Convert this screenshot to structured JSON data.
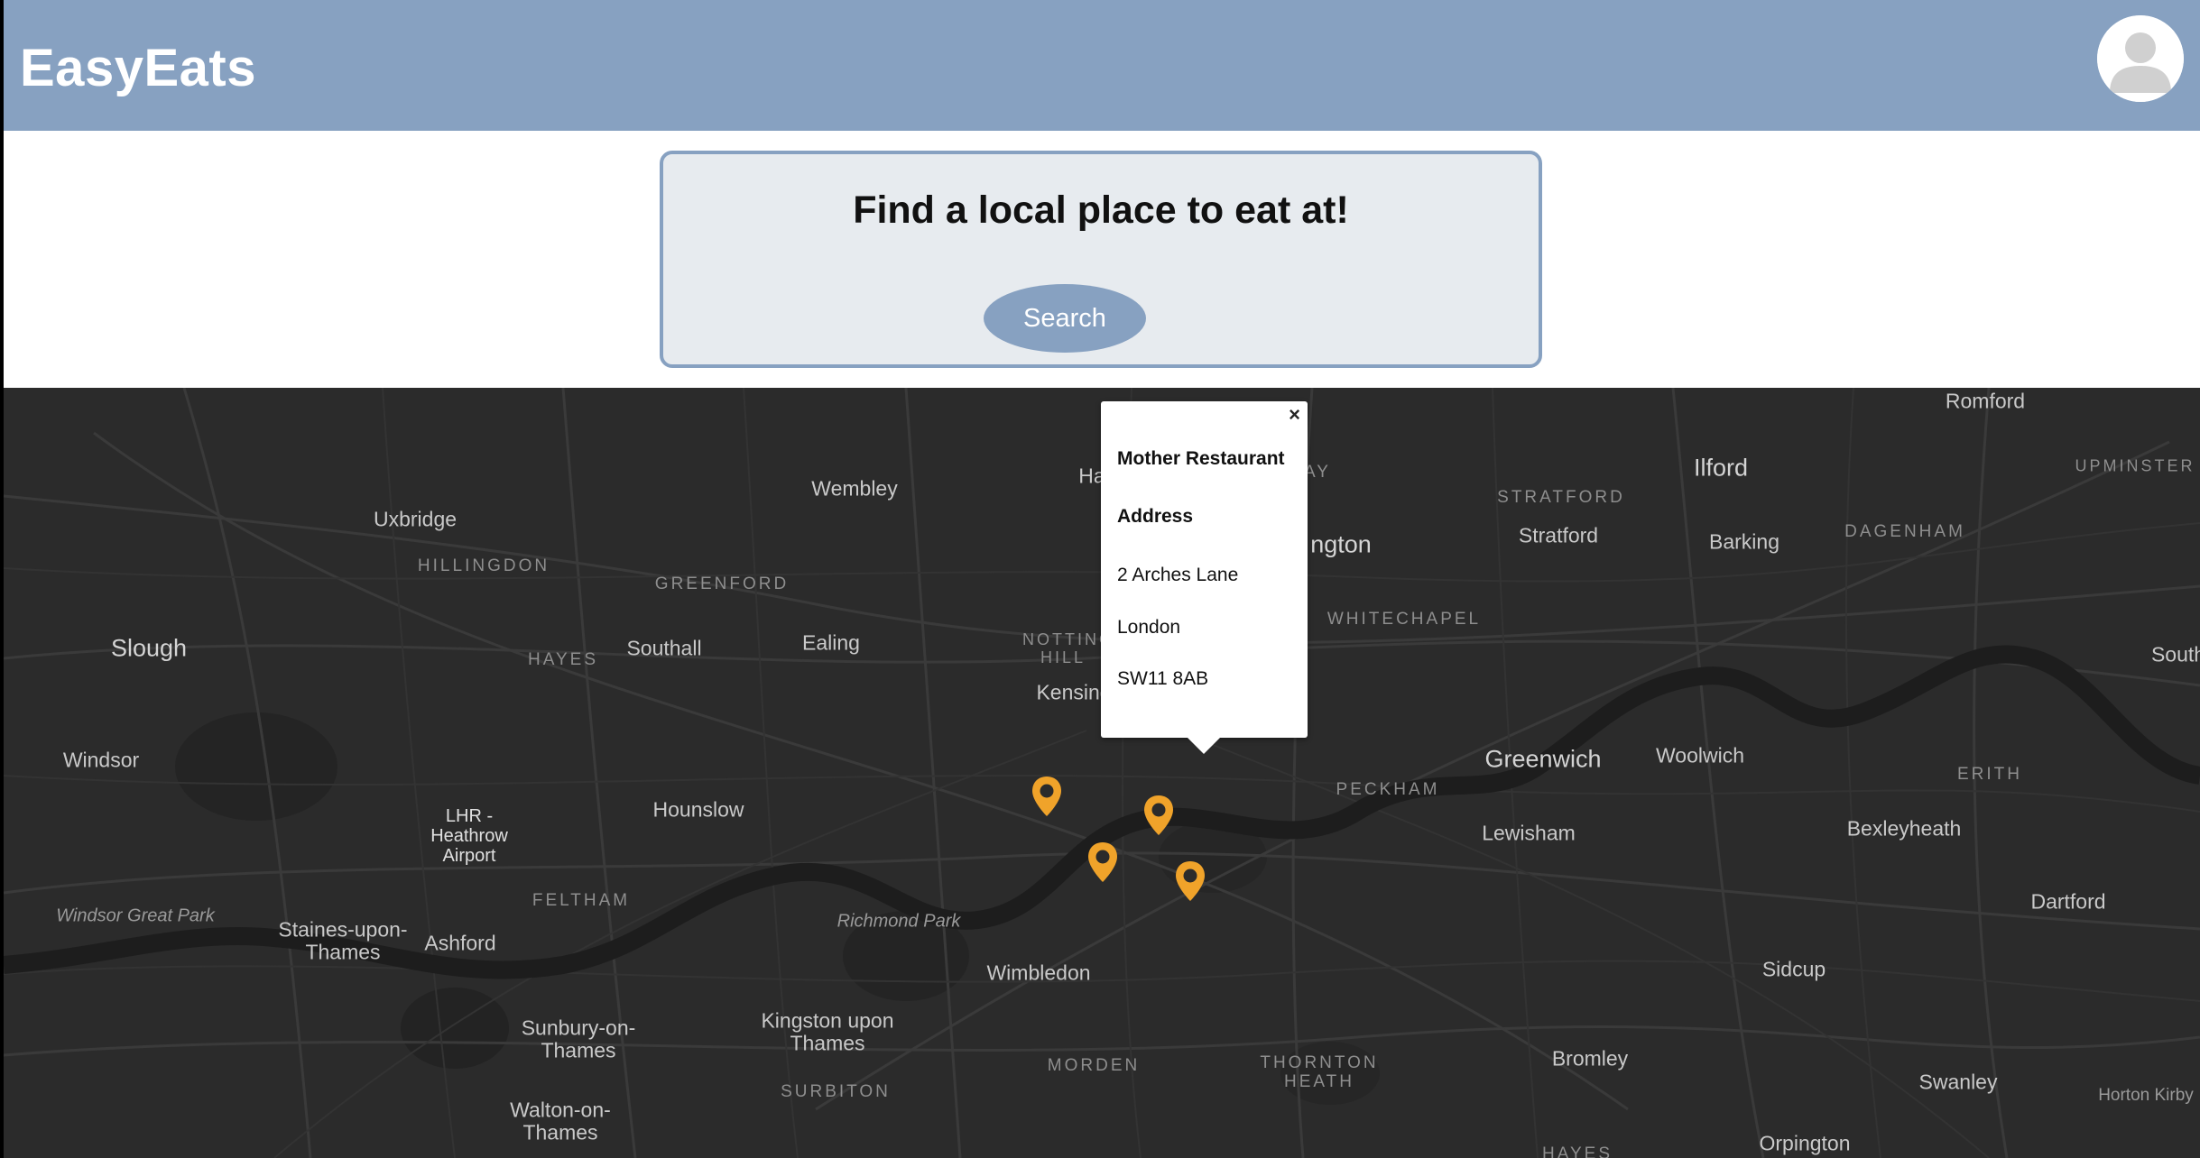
{
  "header": {
    "title": "EasyEats",
    "avatar_icon": "user-avatar-icon"
  },
  "search": {
    "title": "Find a local place to eat at!",
    "button_label": "Search"
  },
  "map": {
    "marker_icon": "location-pin-icon",
    "marker_color": "#f0a32a",
    "places": [
      {
        "label": "Romford",
        "style": "normal"
      },
      {
        "label": "Ilford",
        "style": "big"
      },
      {
        "label": "UPMINSTER",
        "style": "district"
      },
      {
        "label": "Wembley",
        "style": "normal"
      },
      {
        "label": "Uxbridge",
        "style": "normal"
      },
      {
        "label": "HILLINGDON",
        "style": "district"
      },
      {
        "label": "GREENFORD",
        "style": "district"
      },
      {
        "label": "STRATFORD",
        "style": "district"
      },
      {
        "label": "Stratford",
        "style": "normal"
      },
      {
        "label": "Barking",
        "style": "normal"
      },
      {
        "label": "DAGENHAM",
        "style": "district"
      },
      {
        "label": "Slough",
        "style": "big"
      },
      {
        "label": "HAYES",
        "style": "district"
      },
      {
        "label": "Southall",
        "style": "normal"
      },
      {
        "label": "Ealing",
        "style": "normal"
      },
      {
        "label": "WHITECHAPEL",
        "style": "district"
      },
      {
        "label": "South",
        "style": "normal"
      },
      {
        "label": "Windsor",
        "style": "normal"
      },
      {
        "label": "Hounslow",
        "style": "normal"
      },
      {
        "label": "PECKHAM",
        "style": "district"
      },
      {
        "label": "Greenwich",
        "style": "big"
      },
      {
        "label": "Woolwich",
        "style": "normal"
      },
      {
        "label": "ERITH",
        "style": "district"
      },
      {
        "label": "Lewisham",
        "style": "normal"
      },
      {
        "label": "Bexleyheath",
        "style": "normal"
      },
      {
        "label": "LHR - Heathrow Airport",
        "style": "airport"
      },
      {
        "label": "FELTHAM",
        "style": "district"
      },
      {
        "label": "Windsor Great Park",
        "style": "park"
      },
      {
        "label": "Richmond Park",
        "style": "park"
      },
      {
        "label": "Dartford",
        "style": "normal"
      },
      {
        "label": "Staines-upon-Thames",
        "style": "multi"
      },
      {
        "label": "Ashford",
        "style": "normal"
      },
      {
        "label": "Wimbledon",
        "style": "normal"
      },
      {
        "label": "Sidcup",
        "style": "normal"
      },
      {
        "label": "Kingston upon Thames",
        "style": "multi"
      },
      {
        "label": "Sunbury-on-Thames",
        "style": "multi"
      },
      {
        "label": "MORDEN",
        "style": "district"
      },
      {
        "label": "THORNTON HEATH",
        "style": "district"
      },
      {
        "label": "Bromley",
        "style": "normal"
      },
      {
        "label": "Swanley",
        "style": "normal"
      },
      {
        "label": "Horton Kirby",
        "style": "normal"
      },
      {
        "label": "SURBITON",
        "style": "district"
      },
      {
        "label": "Walton-on-Thames",
        "style": "multi"
      },
      {
        "label": "Orpington",
        "style": "normal"
      },
      {
        "label": "HAYES",
        "style": "district"
      },
      {
        "label": "NOTTING HILL",
        "style": "district"
      },
      {
        "label": "Kensing",
        "style": "normal"
      },
      {
        "label": "ngton",
        "style": "big"
      },
      {
        "label": "AY",
        "style": "district"
      },
      {
        "label": "Ha",
        "style": "normal"
      }
    ],
    "popup": {
      "name": "Mother Restaurant",
      "address_heading": "Address",
      "street": "2 Arches Lane",
      "city": "London",
      "postcode": "SW11 8AB",
      "close_label": "×"
    }
  }
}
